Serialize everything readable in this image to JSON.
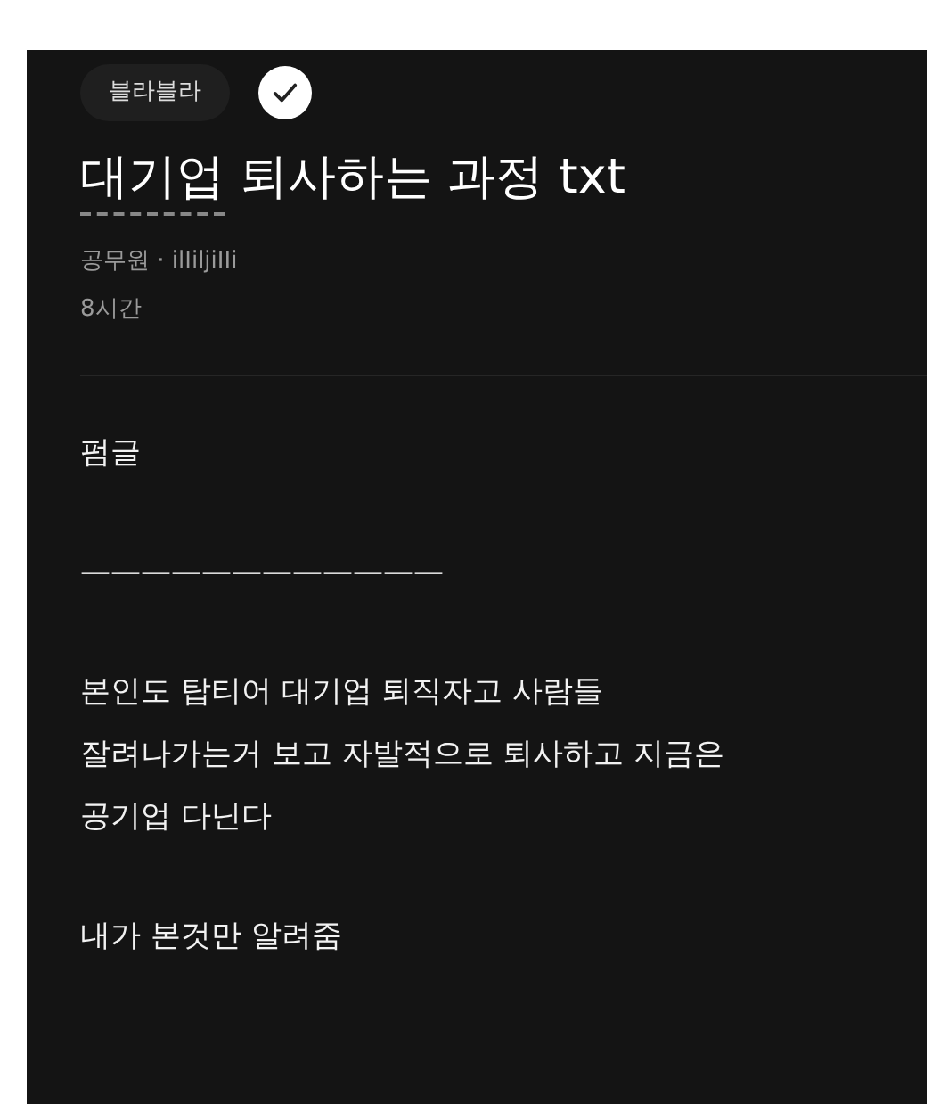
{
  "tag": "블라블라",
  "verified": true,
  "title_segments": [
    {
      "text": "대기업",
      "underlined": true
    },
    {
      "text": " 퇴사하는 과정 txt",
      "underlined": false
    }
  ],
  "author": "공무원 · ilIiljiIIi",
  "time": "8시간",
  "body": [
    "펌글",
    "————————————",
    "본인도 탑티어 대기업 퇴직자고 사람들\n잘려나가는거 보고 자발적으로 퇴사하고 지금은\n공기업 다닌다",
    "내가 본것만 알려줌"
  ]
}
